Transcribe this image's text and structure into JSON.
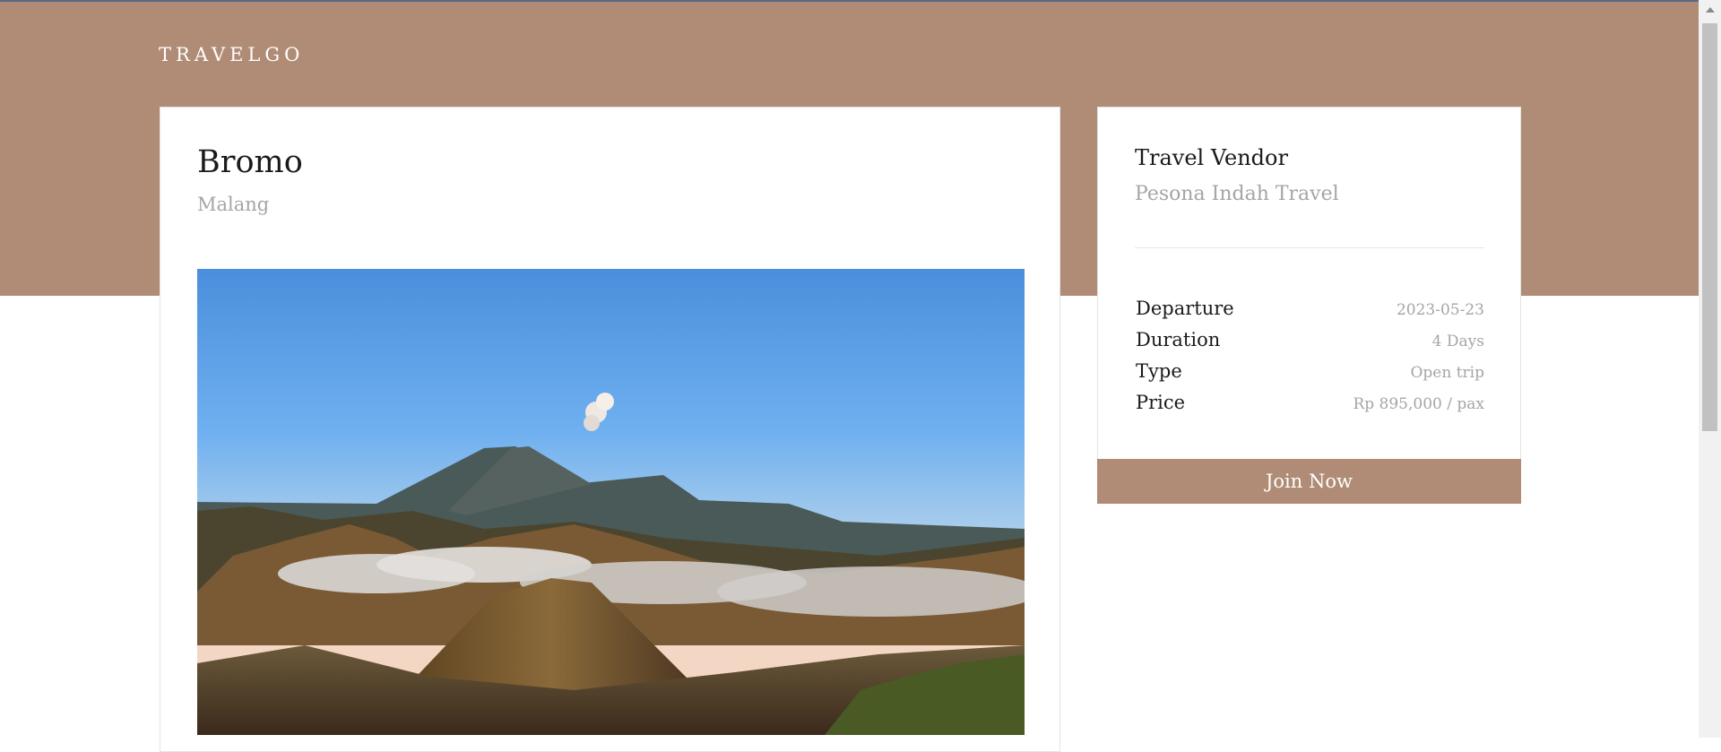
{
  "header": {
    "brand": "TRAVELGO"
  },
  "destination": {
    "title": "Bromo",
    "location": "Malang",
    "image_alt": "Mount Bromo volcano landscape"
  },
  "vendor": {
    "label": "Travel Vendor",
    "name": "Pesona Indah Travel"
  },
  "details": [
    {
      "label": "Departure",
      "value": "2023-05-23"
    },
    {
      "label": "Duration",
      "value": "4 Days"
    },
    {
      "label": "Type",
      "value": "Open trip"
    },
    {
      "label": "Price",
      "value": "Rp 895,000 / pax"
    }
  ],
  "actions": {
    "join_label": "Join Now"
  },
  "colors": {
    "accent": "#b08c76",
    "muted_text": "#a5a5a5"
  }
}
